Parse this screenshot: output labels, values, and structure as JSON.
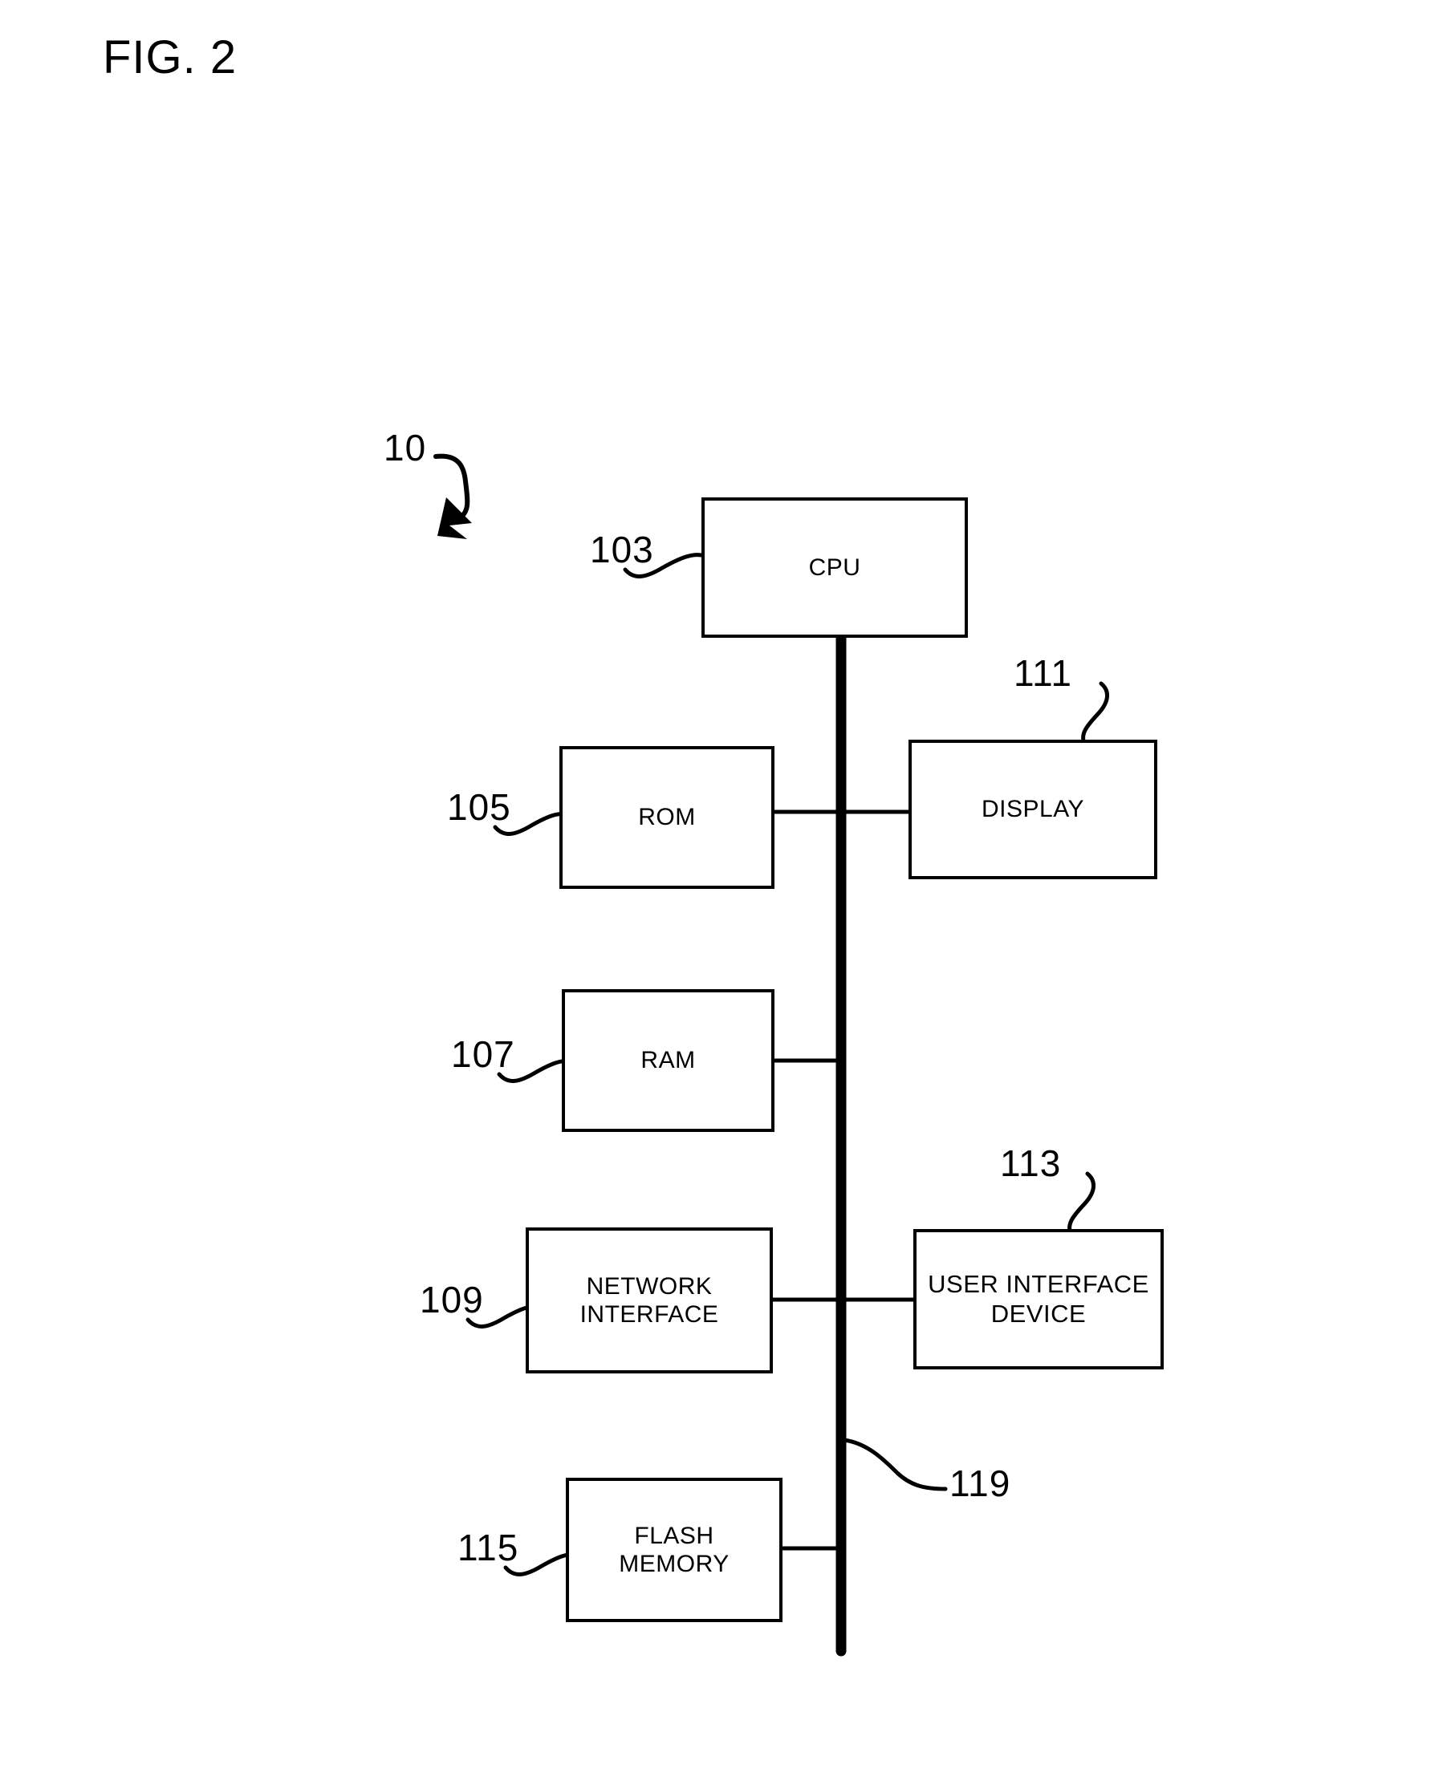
{
  "figure": {
    "title": "FIG. 2",
    "system_ref": "10"
  },
  "diagram": {
    "type": "block-diagram",
    "description": "Hardware block diagram of a device connected by a bus",
    "bus": {
      "ref": "119",
      "name": "bus"
    },
    "nodes": [
      {
        "id": "cpu",
        "ref": "103",
        "label": "CPU",
        "ref_position": "left"
      },
      {
        "id": "rom",
        "ref": "105",
        "label": "ROM",
        "ref_position": "left"
      },
      {
        "id": "ram",
        "ref": "107",
        "label": "RAM",
        "ref_position": "left"
      },
      {
        "id": "network-interface",
        "ref": "109",
        "label": "NETWORK\nINTERFACE",
        "ref_position": "left"
      },
      {
        "id": "flash-memory",
        "ref": "115",
        "label": "FLASH\nMEMORY",
        "ref_position": "left"
      },
      {
        "id": "display",
        "ref": "111",
        "label": "DISPLAY",
        "ref_position": "top"
      },
      {
        "id": "user-interface-device",
        "ref": "113",
        "label": "USER INTERFACE\nDEVICE",
        "ref_position": "top"
      }
    ],
    "connections": [
      {
        "from": "cpu",
        "to": "bus"
      },
      {
        "from": "rom",
        "to": "bus"
      },
      {
        "from": "ram",
        "to": "bus"
      },
      {
        "from": "network-interface",
        "to": "bus"
      },
      {
        "from": "flash-memory",
        "to": "bus"
      },
      {
        "from": "bus",
        "to": "display"
      },
      {
        "from": "bus",
        "to": "user-interface-device"
      }
    ]
  },
  "colors": {
    "ink": "#000000",
    "paper": "#ffffff"
  }
}
